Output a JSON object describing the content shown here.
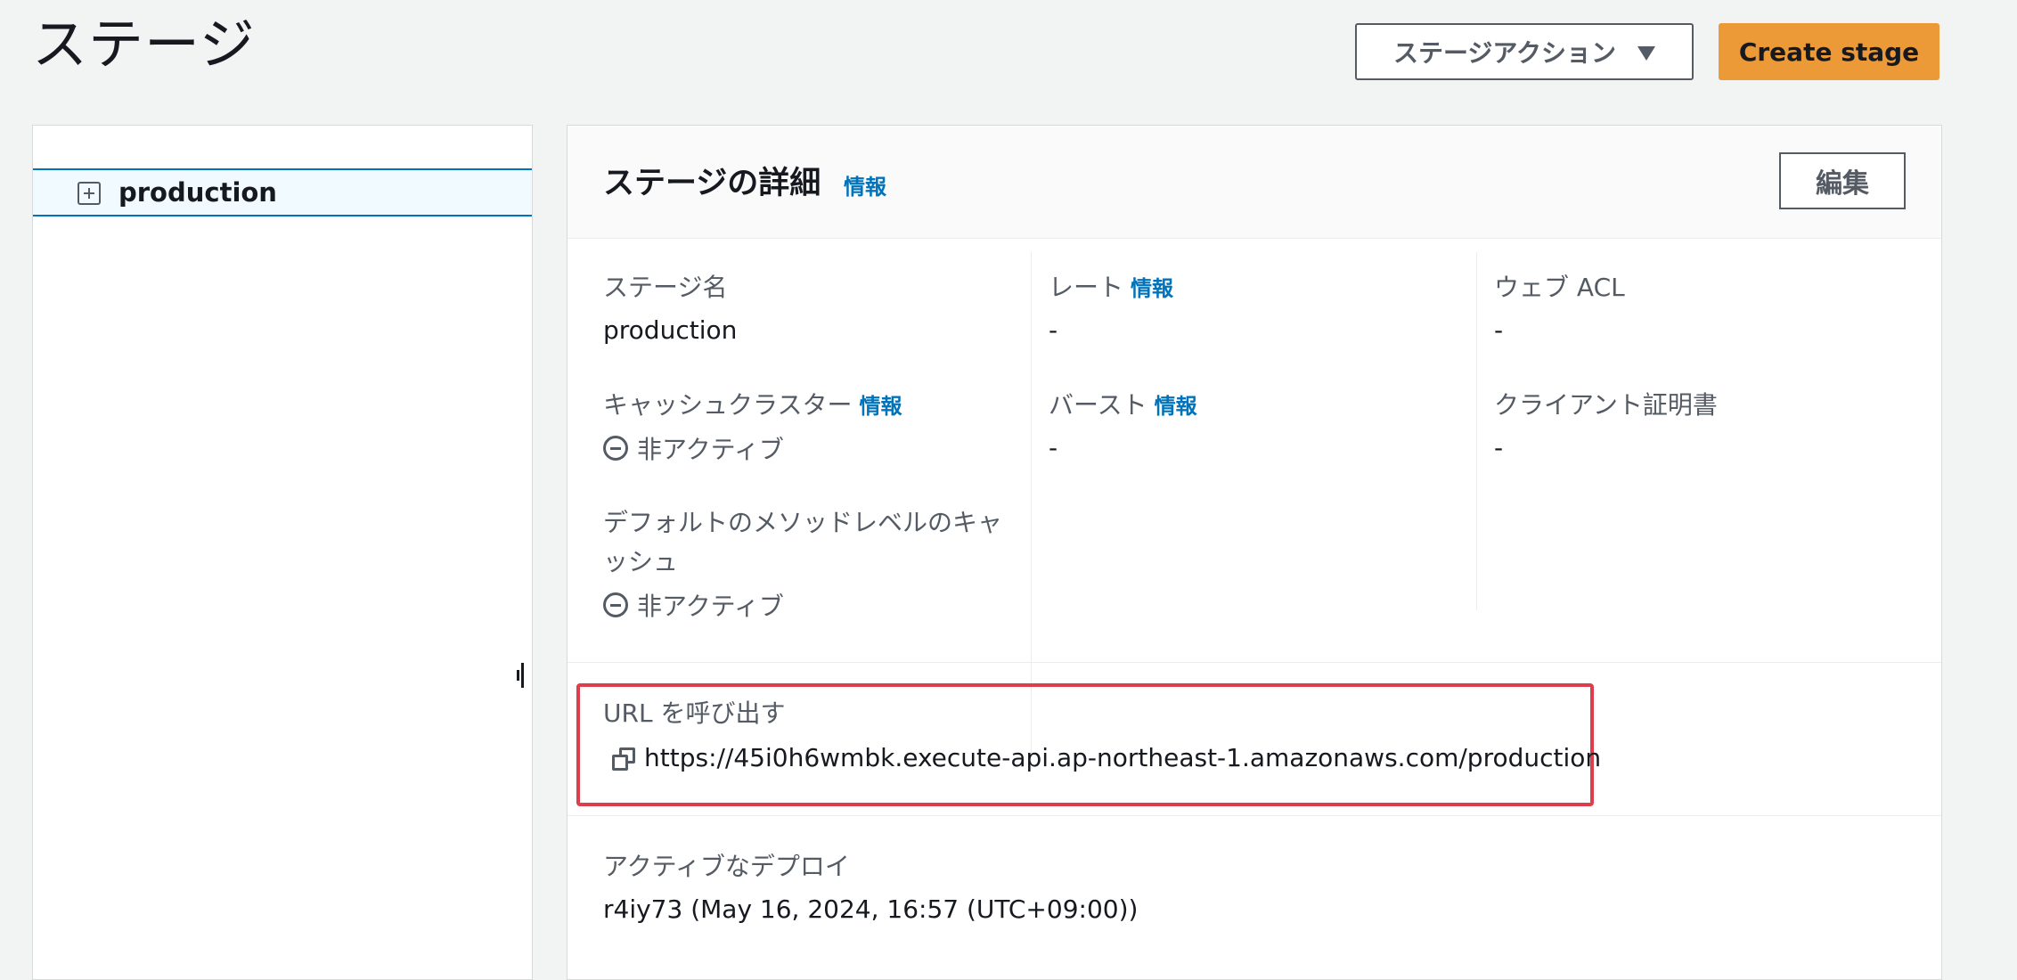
{
  "page": {
    "title": "ステージ"
  },
  "toolbar": {
    "stage_actions_label": "ステージアクション",
    "create_stage_label": "Create stage"
  },
  "stage_tree": {
    "items": [
      {
        "label": "production",
        "selected": true,
        "icon": "expand-plus-icon"
      }
    ]
  },
  "stage_details": {
    "title": "ステージの詳細",
    "info_label": "情報",
    "edit_label": "編集",
    "stage_name": {
      "label": "ステージ名",
      "value": "production"
    },
    "cache_cluster": {
      "label": "キャッシュクラスター",
      "info": "情報",
      "status": "非アクティブ",
      "icon": "minus-circle-icon"
    },
    "default_method_cache": {
      "label_line1": "デフォルトのメソッドレベルのキャ",
      "label_line2": "ッシュ",
      "status": "非アクティブ",
      "icon": "minus-circle-icon"
    },
    "rate": {
      "label": "レート",
      "info": "情報",
      "value": "-"
    },
    "burst": {
      "label": "バースト",
      "info": "情報",
      "value": "-"
    },
    "web_acl": {
      "label": "ウェブ ACL",
      "value": "-"
    },
    "client_certificate": {
      "label": "クライアント証明書",
      "value": "-"
    },
    "invoke_url": {
      "label": "URL を呼び出す",
      "value": "https://45i0h6wmbk.execute-api.ap-northeast-1.amazonaws.com/production",
      "icon": "copy-icon",
      "highlight_color": "#de3d4b"
    },
    "active_deployment": {
      "label": "アクティブなデプロイ",
      "value": "r4iy73 (May 16, 2024, 16:57 (UTC+09:00))"
    }
  },
  "colors": {
    "primary_button": "#ec9a37",
    "link": "#0073bb",
    "highlight": "#de3d4b",
    "background": "#f2f3f3"
  }
}
